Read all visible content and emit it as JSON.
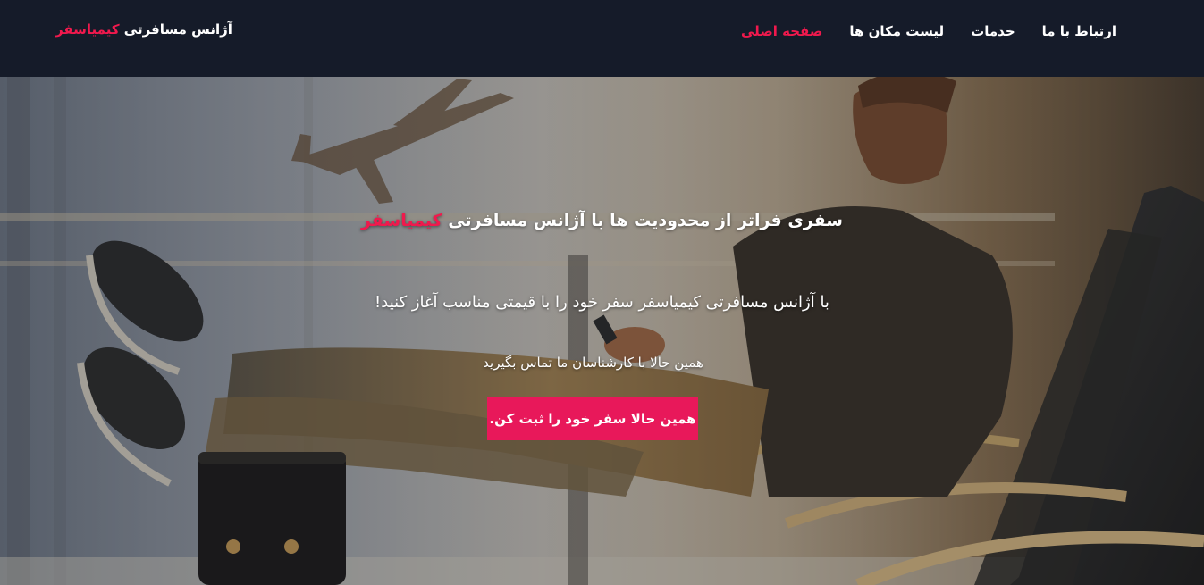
{
  "navbar": {
    "brand_prefix": "آژانس مسافرتی",
    "brand_name": "کیمیاسفر",
    "links": [
      {
        "label": "صفحه اصلی",
        "active": true
      },
      {
        "label": "لیست مکان ها",
        "active": false
      },
      {
        "label": "خدمات",
        "active": false
      },
      {
        "label": "ارتباط با ما",
        "active": false
      }
    ]
  },
  "hero": {
    "headline_prefix": "سفری فراتر از محدودیت ها با آژانس مسافرتی",
    "headline_brand": "کیمیاسفر",
    "subline": "با آژانس مسافرتی کیمیاسفر سفر خود را با قیمتی مناسب آغاز کنید!",
    "contact_line": "همین حالا با کارشناسان ما تماس بگیرید",
    "cta_label": "همین حالا سفر خود را ثبت کن.",
    "background_image": "traveler-with-feet-on-suitcase-airport"
  },
  "colors": {
    "navbar_bg": "#151b29",
    "accent": "#f0194d",
    "cta_bg": "#e8185a",
    "text": "#ffffff"
  }
}
